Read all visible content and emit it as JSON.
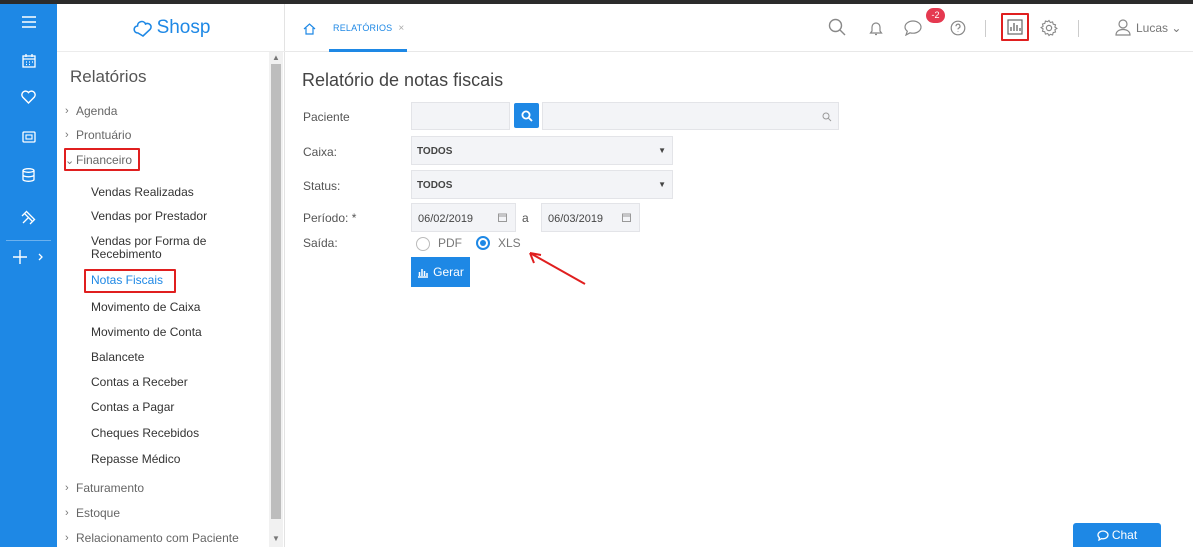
{
  "app": {
    "brand": "Shosp"
  },
  "sidebar": {
    "title": "Relatórios",
    "sections": [
      {
        "label": "Agenda"
      },
      {
        "label": "Prontuário"
      },
      {
        "label": "Financeiro"
      },
      {
        "label": "Faturamento"
      },
      {
        "label": "Estoque"
      },
      {
        "label": "Relacionamento com Paciente"
      }
    ],
    "financeiro_items": [
      {
        "label": "Vendas Realizadas"
      },
      {
        "label": "Vendas por Prestador"
      },
      {
        "label": "Vendas por Forma de"
      },
      {
        "label": "Recebimento"
      },
      {
        "label": "Notas Fiscais"
      },
      {
        "label": "Movimento de Caixa"
      },
      {
        "label": "Movimento de Conta"
      },
      {
        "label": "Balancete"
      },
      {
        "label": "Contas a Receber"
      },
      {
        "label": "Contas a Pagar"
      },
      {
        "label": "Cheques Recebidos"
      },
      {
        "label": "Repasse Médico"
      }
    ]
  },
  "header": {
    "tab_label": "RELATÓRIOS",
    "tab_close": "×",
    "notifications_badge": "-2",
    "user_name": "Lucas"
  },
  "main": {
    "title": "Relatório de notas fiscais",
    "fields": {
      "paciente_label": "Paciente",
      "caixa_label": "Caixa:",
      "caixa_value": "TODOS",
      "status_label": "Status:",
      "status_value": "TODOS",
      "periodo_label": "Período: *",
      "periodo_start": "06/02/2019",
      "periodo_sep": "a",
      "periodo_end": "06/03/2019",
      "saida_label": "Saída:",
      "option_pdf": "PDF",
      "option_xls": "XLS",
      "selected_output": "XLS"
    },
    "generate_label": "Gerar"
  },
  "chat": {
    "label": "Chat"
  },
  "colors": {
    "accent": "#1e88e5",
    "highlight": "#e01f1f",
    "badge": "#e53950"
  }
}
